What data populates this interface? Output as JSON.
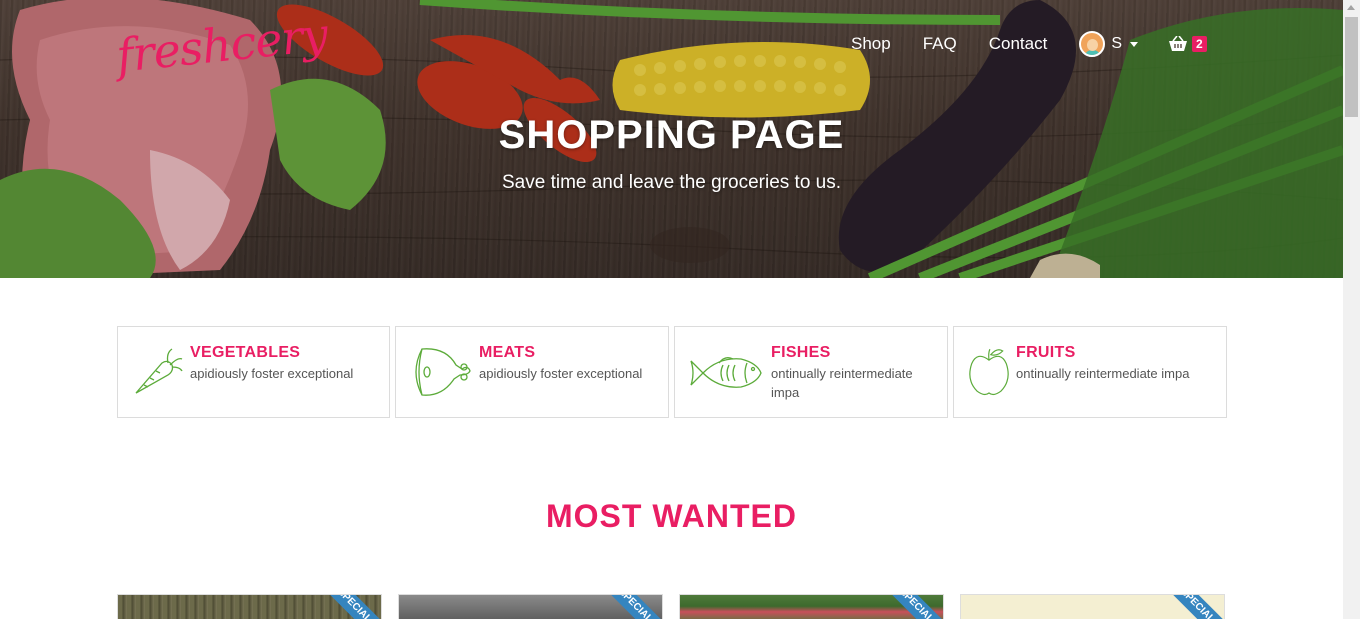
{
  "brand": {
    "logo_text": "freshcery",
    "accent": "#e91e63"
  },
  "nav": {
    "links": [
      "Shop",
      "FAQ",
      "Contact"
    ],
    "user_initial": "S",
    "cart_count": "2"
  },
  "hero": {
    "title": "SHOPPING PAGE",
    "subtitle": "Save time and leave the groceries to us."
  },
  "categories": [
    {
      "title": "VEGETABLES",
      "desc": "apidiously foster exceptional",
      "icon": "carrot-icon"
    },
    {
      "title": "MEATS",
      "desc": "apidiously foster exceptional",
      "icon": "ham-icon"
    },
    {
      "title": "FISHES",
      "desc": "ontinually reintermediate impa",
      "icon": "fish-icon"
    },
    {
      "title": "FRUITS",
      "desc": "ontinually reintermediate impa",
      "icon": "apple-icon"
    }
  ],
  "most_wanted": {
    "title": "MOST WANTED",
    "ribbon_label": "SPECIAL"
  }
}
